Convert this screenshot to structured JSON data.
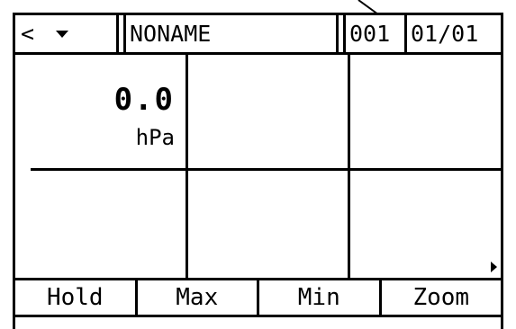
{
  "header": {
    "nav_glyph": "<",
    "nav_dropdown_icon": "chevron-down-icon",
    "filename": "NONAME",
    "record_number": "001",
    "page_indicator": "01/01"
  },
  "measurement": {
    "value": "0.0",
    "unit": "hPa"
  },
  "softkeys": {
    "hold": "Hold",
    "max": "Max",
    "min": "Min",
    "zoom": "Zoom"
  }
}
